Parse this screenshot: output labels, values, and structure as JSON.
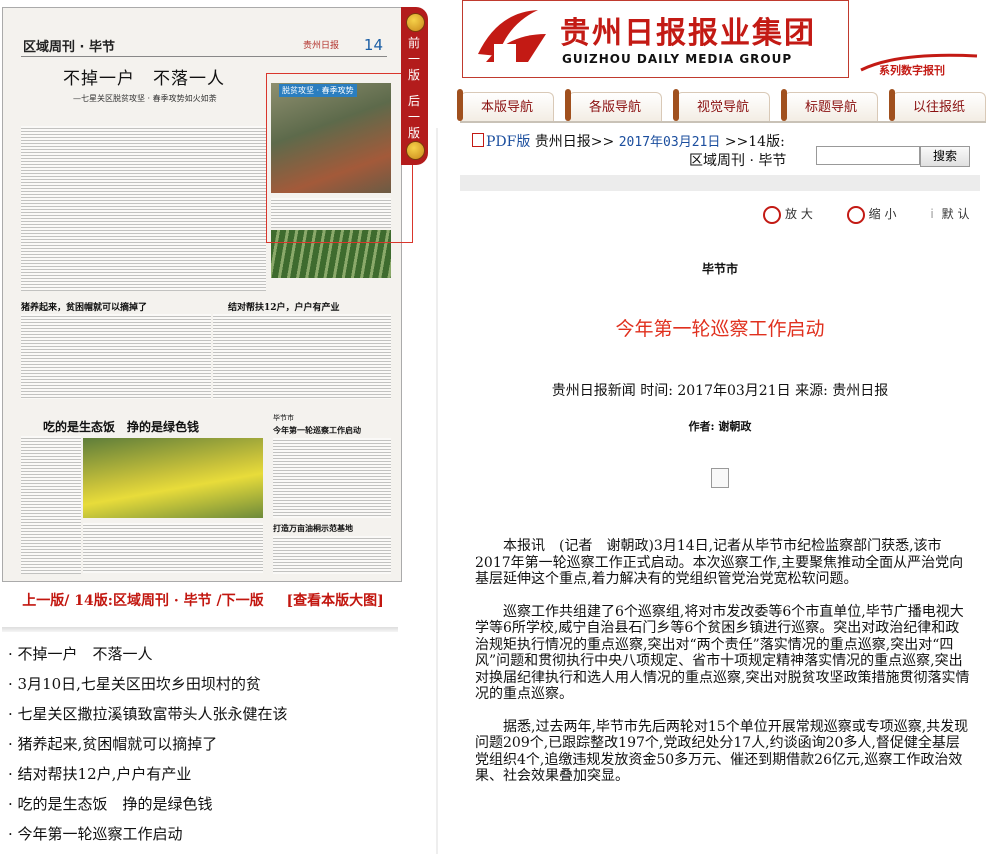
{
  "paper": {
    "section": "区域周刊 · 毕节",
    "page_no": "14",
    "logo": "贵州日报",
    "headline": "不掉一户　不落一人",
    "subhead": "—七星关区脱贫攻坚 · 春季攻势如火如荼",
    "photo_caption": "脱贫攻坚 · 春季攻势",
    "mid_head_1": "猪养起来，贫困帽就可以摘掉了",
    "mid_head_2": "结对帮扶12户，户户有产业",
    "bottom_head": "吃的是生态饭　挣的是绿色钱",
    "right_sec": "毕节市",
    "right_head_1": "今年第一轮巡察工作启动",
    "right_head_2": "打造万亩油桐示范基地"
  },
  "vnav": {
    "prev": "前一版",
    "next": "后一版"
  },
  "pagenav": {
    "prev": "上一版/",
    "current": "14版:区域周刊 · 毕节",
    "next": "/下一版",
    "bigimg": "[查看本版大图]"
  },
  "articles": [
    "· 不掉一户　不落一人",
    "· 3月10日,七星关区田坎乡田坝村的贫",
    "· 七星关区撒拉溪镇致富带头人张永健在该",
    "· 猪养起来,贫困帽就可以摘掉了",
    "· 结对帮扶12户,户户有产业",
    "· 吃的是生态饭　挣的是绿色钱",
    "· 今年第一轮巡察工作启动"
  ],
  "header": {
    "logo_cn": "贵州日报报业集团",
    "logo_en": "GUIZHOU DAILY MEDIA GROUP",
    "digital": "系列数字报刊"
  },
  "tabs": [
    "本版导航",
    "各版导航",
    "视觉导航",
    "标题导航",
    "以往报纸"
  ],
  "path": {
    "pdf": "PDF版",
    "paper": "贵州日报>>",
    "date": "2017年03月21日",
    "page": ">>14版:",
    "page2": "区域周刊 · 毕节"
  },
  "search": {
    "value": "",
    "button": "搜索"
  },
  "zoom": {
    "in": "放 大",
    "out": "缩 小",
    "reset": "默 认"
  },
  "article": {
    "section": "毕节市",
    "title": "今年第一轮巡察工作启动",
    "meta": "贵州日报新闻 时间: 2017年03月21日 来源: 贵州日报",
    "author": "作者: 谢朝政",
    "paragraphs": [
      "本报讯　(记者　谢朝政)3月14日,记者从毕节市纪检监察部门获悉,该市2017年第一轮巡察工作正式启动。本次巡察工作,主要聚焦推动全面从严治党向基层延伸这个重点,着力解决有的党组织管党治党宽松软问题。",
      "巡察工作共组建了6个巡察组,将对市发改委等6个市直单位,毕节广播电视大学等6所学校,威宁自治县石门乡等6个贫困乡镇进行巡察。突出对政治纪律和政治规矩执行情况的重点巡察,突出对“两个责任”落实情况的重点巡察,突出对“四风”问题和贯彻执行中央八项规定、省市十项规定精神落实情况的重点巡察,突出对换届纪律执行和选人用人情况的重点巡察,突出对脱贫攻坚政策措施贯彻落实情况的重点巡察。",
      "据悉,过去两年,毕节市先后两轮对15个单位开展常规巡察或专项巡察,共发现问题209个,已跟踪整改197个,党政纪处分17人,约谈函询20多人,督促健全基层党组织4个,追缴违规发放资金50多万元、催还到期借款26亿元,巡察工作政治效果、社会效果叠加突显。"
    ]
  },
  "colors": {
    "brand_red": "#c31a14",
    "title_red": "#e0301e",
    "link_blue": "#1b4e9e"
  }
}
